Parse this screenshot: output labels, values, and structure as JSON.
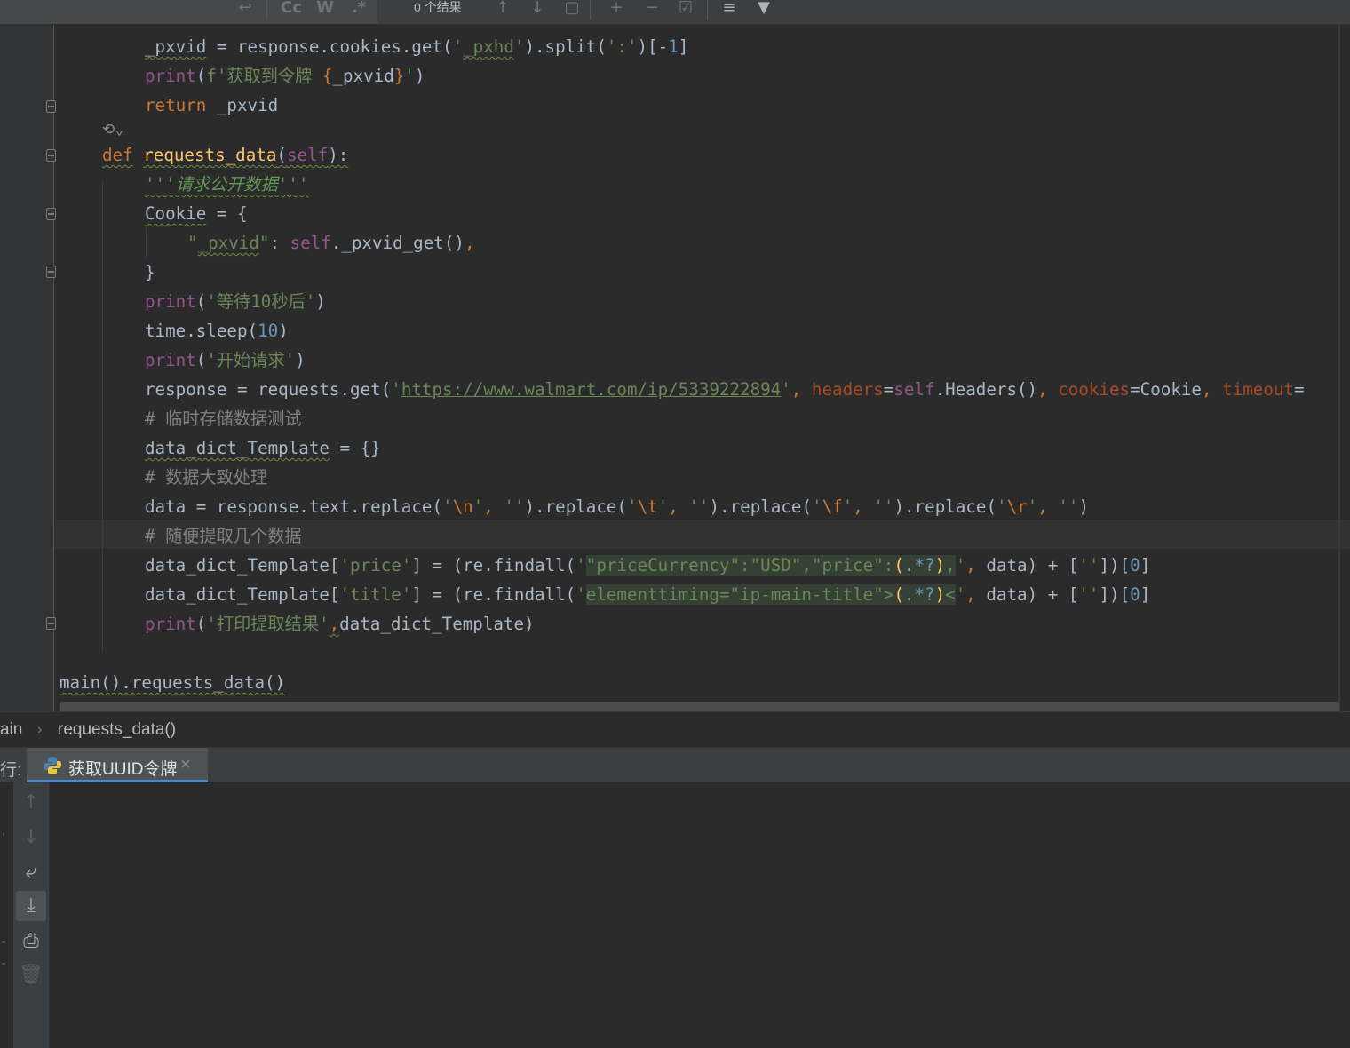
{
  "find_bar": {
    "result_count": "0 个结果",
    "match_case_label": "Cc",
    "words_label": "W",
    "regex_label": ".*"
  },
  "editor": {
    "lines": [
      "_pxvid = response.cookies.get('_pxhd').split(':')[-1]",
      "print(f'获取到令牌 {_pxvid}')",
      "return _pxvid",
      "def requests_data(self):",
      "'''请求公开数据'''",
      "Cookie = {",
      "\"_pxvid\": self._pxvid_get(),",
      "}",
      "print('等待10秒后')",
      "time.sleep(10)",
      "print('开始请求')",
      "response = requests.get('https://www.walmart.com/ip/5339222894', headers=self.Headers(), cookies=Cookie, timeout=",
      "# 临时存储数据测试",
      "data_dict_Template = {}",
      "# 数据大致处理",
      "data = response.text.replace('\\n', '').replace('\\t', '').replace('\\f', '').replace('\\r', '')",
      "# 随便提取几个数据",
      "data_dict_Template['price'] = (re.findall('\"priceCurrency\":\"USD\",\"price\":(.*?),', data) + [''])[0]",
      "data_dict_Template['title'] = (re.findall('elementtiming=\"ip-main-title\">(.*?)<', data) + [''])[0]",
      "print('打印提取结果',data_dict_Template)",
      "main().requests_data()"
    ]
  },
  "breadcrumb": {
    "class_name": "ain",
    "method_name": "requests_data()"
  },
  "run_panel": {
    "label": "行:",
    "tab_title": "获取UUID令牌",
    "close_glyph": "×"
  }
}
